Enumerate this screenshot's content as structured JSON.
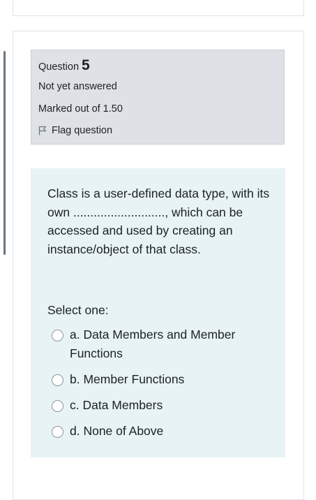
{
  "question_info": {
    "label": "Question",
    "number": "5",
    "state": "Not yet answered",
    "grade": "Marked out of 1.50",
    "flag_label": "Flag question"
  },
  "question": {
    "text": "Class is a user-defined data type, with its own ..........................., which can be accessed and used by creating an instance/object of that class.",
    "prompt": "Select one:",
    "answers": [
      {
        "label": "a. Data Members and Member Functions",
        "selected": false
      },
      {
        "label": "b. Member Functions",
        "selected": false
      },
      {
        "label": "c. Data Members",
        "selected": false
      },
      {
        "label": "d. None of Above",
        "selected": false
      }
    ]
  },
  "icons": {
    "flag": "flag-icon"
  },
  "colors": {
    "info_background": "#dee2e6",
    "formulation_background": "#e7f3f5"
  }
}
